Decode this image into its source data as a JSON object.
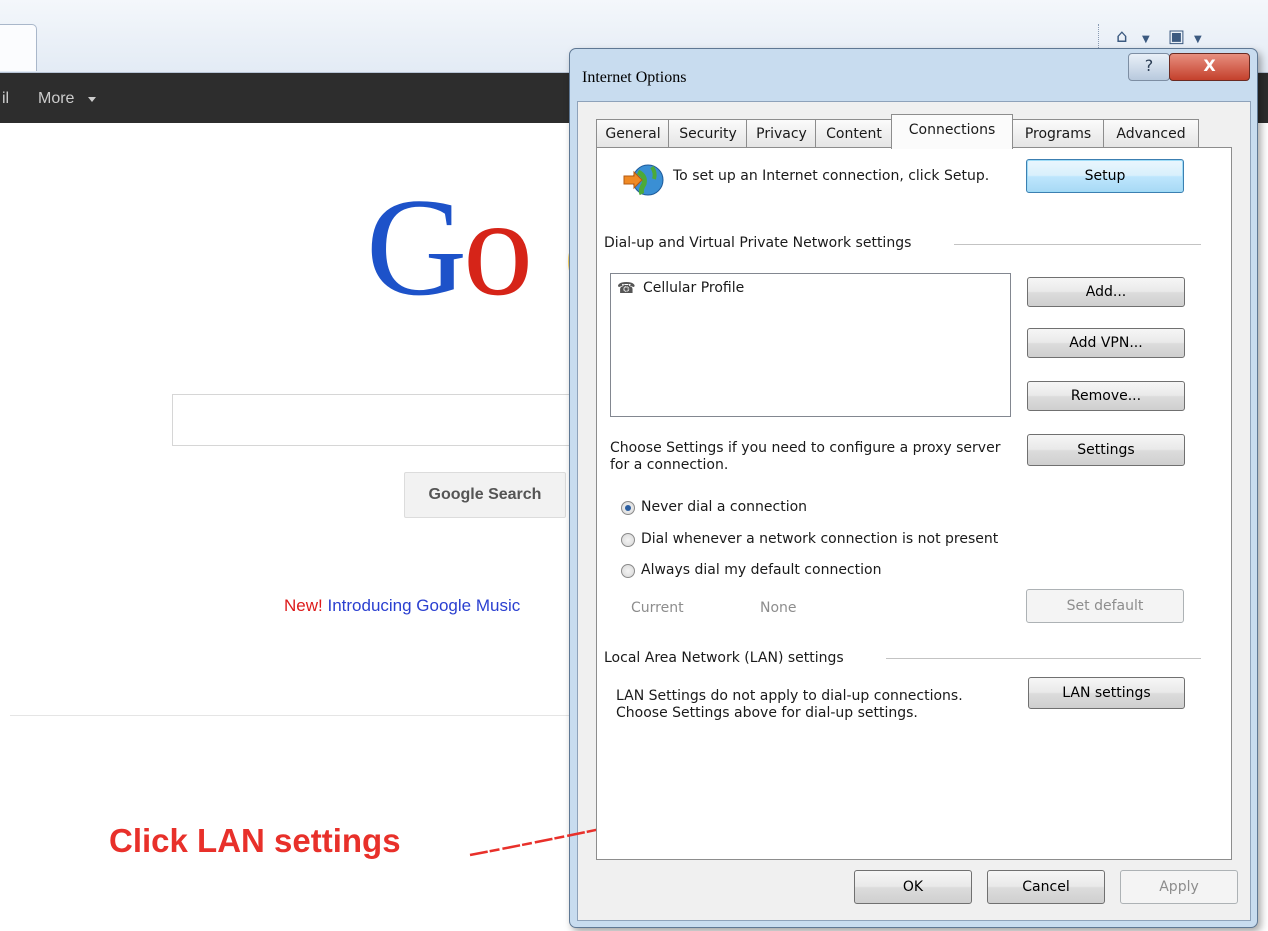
{
  "browser": {
    "gbar_fragment": "il",
    "gbar_more": "More"
  },
  "google_page": {
    "logo_text": "Goo",
    "search_button": "Google Search",
    "promo_new": "New!",
    "promo_link": "Introducing Google Music"
  },
  "dialog": {
    "title": "Internet Options",
    "help_glyph": "?",
    "close_glyph": "X",
    "tabs": [
      "General",
      "Security",
      "Privacy",
      "Content",
      "Connections",
      "Programs",
      "Advanced"
    ],
    "active_tab": "Connections",
    "setup_text": "To set up an Internet connection, click Setup.",
    "setup_button": "Setup",
    "dialup_group": "Dial-up and Virtual Private Network settings",
    "connections_list": [
      "Cellular Profile"
    ],
    "add_button": "Add...",
    "add_vpn_button": "Add VPN...",
    "remove_button": "Remove...",
    "proxy_text": "Choose Settings if you need to configure a proxy server for a connection.",
    "settings_button": "Settings",
    "radio_options": [
      {
        "label": "Never dial a connection",
        "checked": true
      },
      {
        "label": "Dial whenever a network connection is not present",
        "checked": false
      },
      {
        "label": "Always dial my default connection",
        "checked": false
      }
    ],
    "current_label": "Current",
    "current_value": "None",
    "set_default_button": "Set default",
    "lan_group": "Local Area Network (LAN) settings",
    "lan_text": "LAN Settings do not apply to dial-up connections. Choose Settings above for dial-up settings.",
    "lan_button": "LAN settings",
    "ok_button": "OK",
    "cancel_button": "Cancel",
    "apply_button": "Apply"
  },
  "annotation": {
    "text": "Click LAN settings",
    "color": "#e8302a"
  }
}
